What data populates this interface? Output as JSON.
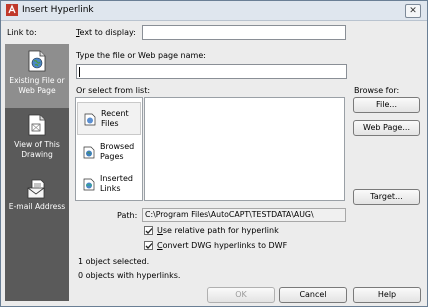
{
  "window": {
    "title": "Insert Hyperlink"
  },
  "link_to": {
    "label": "Link to:",
    "items": [
      {
        "label_line1": "Existing File or",
        "label_line2": "Web Page",
        "icon": "globe-document-icon",
        "selected": true
      },
      {
        "label_line1": "View of This",
        "label_line2": "Drawing",
        "icon": "drawing-view-icon",
        "selected": false
      },
      {
        "label_line1": "E-mail Address",
        "label_line2": "",
        "icon": "email-icon",
        "selected": false
      }
    ]
  },
  "text_to_display": {
    "label": "Text to display:",
    "value": ""
  },
  "type_file": {
    "label": "Type the file or Web page name:",
    "value": ""
  },
  "select_list": {
    "label": "Or select from list:",
    "tabs": [
      {
        "line1": "Recent",
        "line2": "Files",
        "icon": "recent-files-icon",
        "selected": true
      },
      {
        "line1": "Browsed",
        "line2": "Pages",
        "icon": "browsed-pages-icon",
        "selected": false
      },
      {
        "line1": "Inserted",
        "line2": "Links",
        "icon": "inserted-links-icon",
        "selected": false
      }
    ]
  },
  "browse_for": {
    "label": "Browse for:",
    "file_button": "File...",
    "web_page_button": "Web Page...",
    "target_button": "Target..."
  },
  "path": {
    "label": "Path:",
    "value": "C:\\Program Files\\AutoCAPT\\TESTDATA\\AUG\\"
  },
  "options": {
    "relative_path": {
      "label": "Use relative path for hyperlink",
      "checked": true
    },
    "convert_dwg": {
      "label": "Convert DWG hyperlinks to DWF",
      "checked": true
    }
  },
  "status": {
    "selected": "1 object selected.",
    "with_hyperlinks": "0 objects with hyperlinks."
  },
  "footer": {
    "ok": "OK",
    "cancel": "Cancel",
    "help": "Help"
  }
}
